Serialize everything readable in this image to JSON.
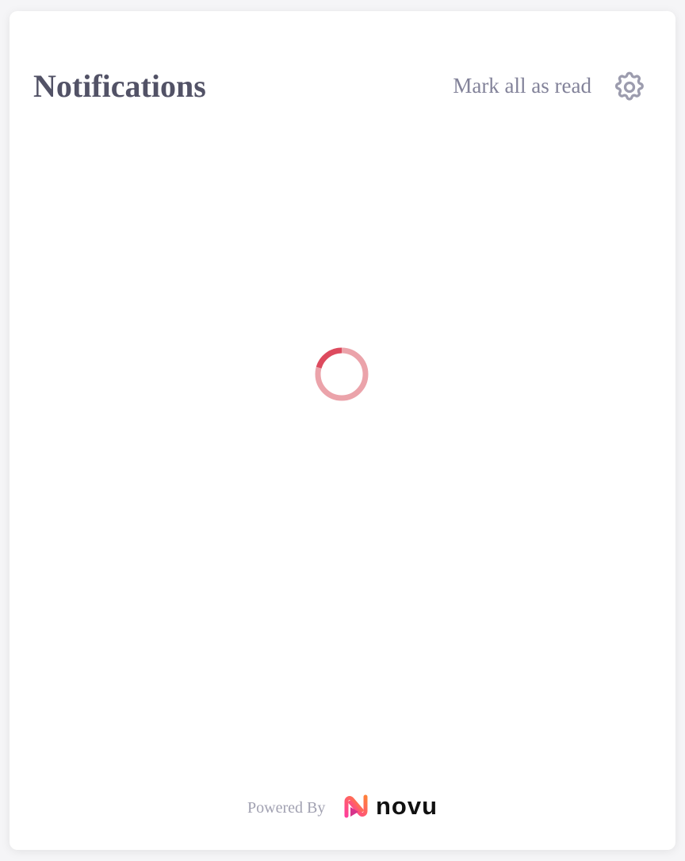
{
  "header": {
    "title": "Notifications",
    "mark_all_label": "Mark all as read"
  },
  "icons": {
    "settings": "gear-icon",
    "loading": "loading-spinner",
    "brand": "novu-logo-icon"
  },
  "footer": {
    "powered_by": "Powered By",
    "brand_name": "novu"
  },
  "colors": {
    "title": "#525266",
    "muted": "#828299",
    "spinner_track": "#eba3aa",
    "spinner_arc": "#dd4a5e",
    "brand_pink": "#ff3e9a",
    "brand_orange": "#ff7f3a"
  }
}
